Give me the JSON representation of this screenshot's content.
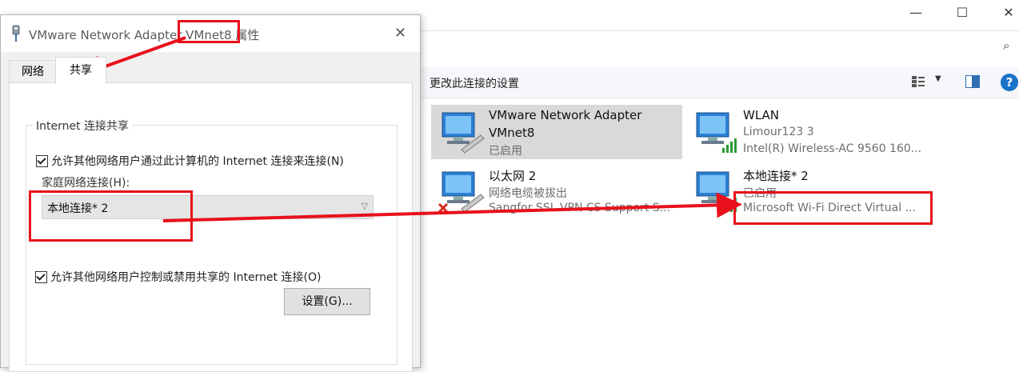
{
  "window_controls": {
    "minimize": "—",
    "maximize": "☐",
    "close": "✕"
  },
  "toolbar": {
    "change_settings": "更改此连接的设置"
  },
  "connections": [
    {
      "name": "VMware Network Adapter",
      "line2": "VMnet8",
      "line3": "已启用",
      "selected": true
    },
    {
      "name": "WLAN",
      "line2": "Limour123 3",
      "line3": "Intel(R) Wireless-AC 9560 160..."
    },
    {
      "name": "以太网 2",
      "line2": "网络电缆被拔出",
      "line3": "Sangfor SSL VPN CS Support S..."
    },
    {
      "name": "本地连接* 2",
      "line2": "已启用",
      "line3": "Microsoft Wi-Fi Direct Virtual ..."
    }
  ],
  "dialog": {
    "title": "VMware Network Adapter VMnet8 属性",
    "tabs": [
      "网络",
      "共享"
    ],
    "active_tab": "共享",
    "group_title": "Internet 连接共享",
    "check_allow_connect": "允许其他网络用户通过此计算机的 Internet 连接来连接(N)",
    "home_network_label": "家庭网络连接(H):",
    "home_network_value": "本地连接* 2",
    "check_allow_control": "允许其他网络用户控制或禁用共享的 Internet 连接(O)",
    "settings_button": "设置(G)..."
  },
  "colors": {
    "annotation": "#e8111c",
    "selected_bg": "#d9d9d9",
    "help": "#1a73c9"
  }
}
